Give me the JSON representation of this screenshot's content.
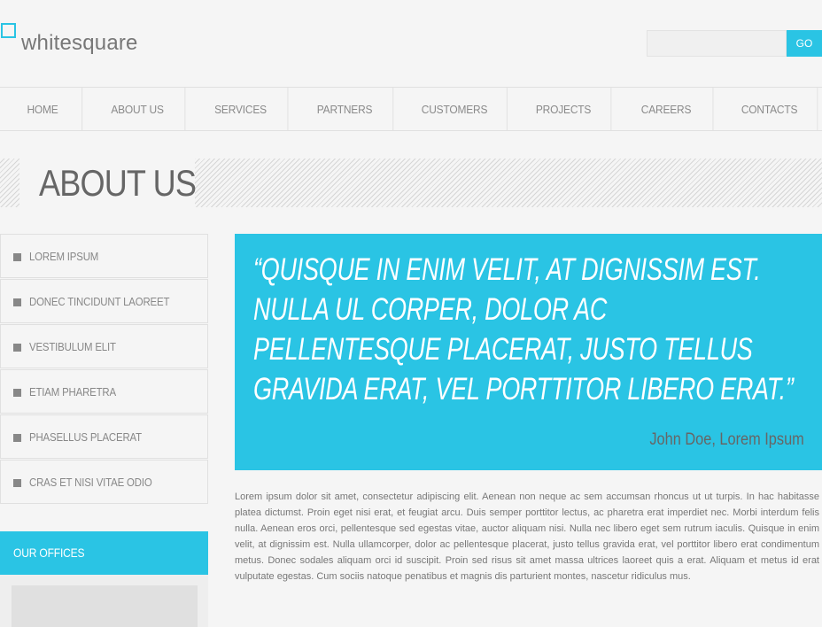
{
  "brand": {
    "logo_text": "whitesquare"
  },
  "search": {
    "placeholder": "",
    "button_label": "GO"
  },
  "nav": {
    "items": [
      {
        "label": "HOME",
        "width": 97
      },
      {
        "label": "ABOUT US",
        "width": 117
      },
      {
        "label": "SERVICES",
        "width": 116
      },
      {
        "label": "PARTNERS",
        "width": 119
      },
      {
        "label": "CUSTOMERS",
        "width": 129
      },
      {
        "label": "PROJECTS",
        "width": 117
      },
      {
        "label": "CAREERS",
        "width": 115
      },
      {
        "label": "CONTACTS",
        "width": 118
      }
    ]
  },
  "page": {
    "title": "ABOUT US"
  },
  "sidebar": {
    "items": [
      {
        "label": "LOREM IPSUM"
      },
      {
        "label": "DONEC TINCIDUNT LAOREET"
      },
      {
        "label": "VESTIBULUM ELIT"
      },
      {
        "label": "ETIAM PHARETRA"
      },
      {
        "label": "PHASELLUS PLACERAT"
      },
      {
        "label": "CRAS ET NISI VITAE ODIO"
      }
    ],
    "offices_title": "OUR OFFICES"
  },
  "quote": {
    "text": "“QUISQUE IN ENIM VELIT, AT DIGNISSIM EST. NULLA UL CORPER, DOLOR AC PELLENTESQUE PLACERAT, JUSTO TELLUS GRAVIDA ERAT, VEL PORTTITOR LIBERO ERAT.”",
    "author": "John Doe, Lorem Ipsum"
  },
  "content": {
    "paragraph": "Lorem ipsum dolor sit amet, consectetur adipiscing elit. Aenean non neque ac sem accumsan rhoncus ut ut turpis. In hac habitasse platea dictumst. Proin eget nisi erat, et feugiat arcu. Duis semper porttitor lectus, ac pharetra erat imperdiet nec. Morbi interdum felis nulla. Aenean eros orci, pellentesque sed egestas vitae, auctor aliquam nisi. Nulla nec libero eget sem rutrum iaculis. Quisque in enim velit, at dignissim est. Nulla ullamcorper, dolor ac pellentesque placerat, justo tellus gravida erat, vel porttitor libero erat condimentum metus. Donec sodales aliquam orci id suscipit. Proin sed risus sit amet massa ultrices laoreet quis a erat. Aliquam et metus id erat vulputate egestas. Cum sociis natoque penatibus et magnis dis parturient montes, nascetur ridiculus mus."
  },
  "colors": {
    "accent": "#2ac4e4",
    "background": "#f5f5f5"
  }
}
